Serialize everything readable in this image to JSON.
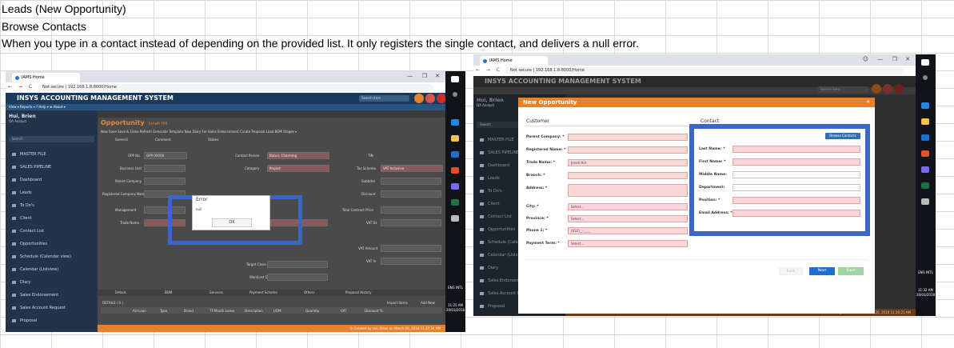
{
  "sheet": {
    "line1": "Leads (New Opportunity)",
    "line2": "Browse Contacts",
    "line3": "When you type in a contact instead of depending on the provided list. It only registers the single contact, and delivers a null error."
  },
  "browser": {
    "tab_title": "IAMS Home",
    "address": "Not secure | 192.168.1.8:8000/Home"
  },
  "app": {
    "title": "INSYS ACCOUNTING MANAGEMENT SYSTEM",
    "search_placeholder": "Search item",
    "menu": "View ▾  Reports ▾  ? Help ▾  ⊕ About ▾",
    "user_name": "Hui, Brien",
    "user_role": "QA Analyst",
    "sidebar_search": "Search",
    "sidebar_items": [
      "MASTER FILE",
      "SALES PIPELINE",
      "Dashboard",
      "Leads",
      "To Do's",
      "Client",
      "Contact List",
      "Opportunities",
      "Schedule (Calendar view)",
      "Calendar (Listview)",
      "Diary",
      "Sales Endorsement",
      "Sales Account Request",
      "Proposal"
    ]
  },
  "left_screen": {
    "page_title": "Opportunity",
    "page_subtitle": "Jonah Hill",
    "toolbar": "New  Save  Save & Close  Refresh  Generate Template  New Diary  For Sales Endorsement  Create Proposal  Load BOM  Stages ▾",
    "tabs": [
      "General",
      "Comment",
      "Stakes"
    ],
    "fields_left": [
      "OPP No.",
      "Business Unit",
      "Parent Company",
      "Registered Company Name",
      "Management",
      "Trade Name"
    ],
    "opp_no_value": "OPP-00008",
    "fields_mid": [
      "Contact Person",
      "Category",
      "Stage",
      "Target Close Date",
      "Won/Lost Date"
    ],
    "contact_person_value": "Buturi, Charming",
    "category_value": "Project",
    "fields_right": [
      "TIN",
      "Tax Scheme",
      "Subtotal",
      "Discount",
      "Total Contract Price",
      "VAT Ex",
      "VAT Amount",
      "VAT In"
    ],
    "tax_scheme_value": "VAT Inclusive",
    "amount_zero": "0.00",
    "bottom_tabs": [
      "Details",
      "BOM",
      "Services",
      "Payment Scheme",
      "Others",
      "Proposal History"
    ],
    "details_label": "DETAILS ( 0 )",
    "import_items": "Import Items",
    "add_new": "Add New",
    "grid_headers": [
      "AU-Lean",
      "Type",
      "Brand",
      "TT-Month Lease",
      "Description",
      "UOM",
      "Quantity",
      "VAT",
      "Discount %"
    ],
    "footer": "© Created by Hui, Brien on March 20, 2018 11:27:24 AM",
    "clock_time": "11:25 AM",
    "clock_date": "20/03/2018",
    "lang": "ENG\nINTL"
  },
  "error_dialog": {
    "title": "Error",
    "message": "null",
    "ok_label": "OK"
  },
  "right_screen": {
    "modal_title": "New Opportunity",
    "customer_title": "Customer",
    "contact_title": "Contact",
    "customer_fields": [
      {
        "label": "Parent Company: *",
        "value": ""
      },
      {
        "label": "Registered Name: *",
        "value": ""
      },
      {
        "label": "Trade Name: *",
        "value": "Jonah Hill"
      },
      {
        "label": "Branch: *",
        "value": ""
      },
      {
        "label": "Address: *",
        "value": ""
      },
      {
        "label": "City: *",
        "value": "Select..."
      },
      {
        "label": "Province: *",
        "value": "Select..."
      },
      {
        "label": "Phone 1: *",
        "value": "(632)__-____"
      },
      {
        "label": "Payment Term: *",
        "value": "Select..."
      }
    ],
    "browse_contacts": "Browse Contacts",
    "contact_fields": [
      {
        "label": "Last Name: *"
      },
      {
        "label": "First Name: *"
      },
      {
        "label": "Middle Name:"
      },
      {
        "label": "Department:"
      },
      {
        "label": "Position: *"
      },
      {
        "label": "Email Address: *"
      }
    ],
    "back_label": "Back",
    "next_label": "Next",
    "save_label": "Save",
    "footer": "© Created by Hui, Brien on March 20, 2018 11:26:21 AM",
    "clock_time": "11:32 AM",
    "clock_date": "20/03/2018",
    "lang": "ENG\nINTL"
  }
}
